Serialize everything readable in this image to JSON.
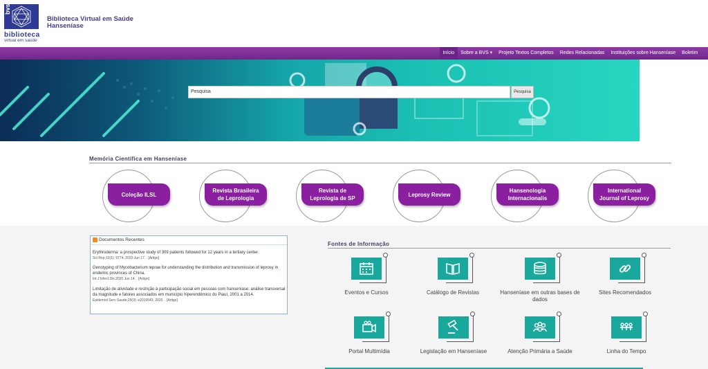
{
  "logo": {
    "mark": "bvs",
    "line1": "biblioteca",
    "line2": "virtual em saúde"
  },
  "site_title": {
    "line1": "Biblioteca Virtual em Saúde",
    "line2": "Hanseníase"
  },
  "nav": [
    {
      "label": "Início",
      "active": true
    },
    {
      "label": "Sobre a BVS ▾",
      "active": false
    },
    {
      "label": "Projeto Textos Completos",
      "active": false
    },
    {
      "label": "Redes Relacionadas",
      "active": false
    },
    {
      "label": "Instituições sobre Hanseníase",
      "active": false
    },
    {
      "label": "Boletim",
      "active": false
    }
  ],
  "search": {
    "placeholder": "Pesquisa",
    "button": "Pesquisa"
  },
  "memoria": {
    "title": "Memória Científica em Hanseníase",
    "items": [
      {
        "line1": "Coleção ILSL",
        "line2": ""
      },
      {
        "line1": "Revista Brasileira",
        "line2": "de Leprologia"
      },
      {
        "line1": "Revista de",
        "line2": "Leprologia de SP"
      },
      {
        "line1": "Leprosy Review",
        "line2": ""
      },
      {
        "line1": "Hansenologia",
        "line2": "Internacionalis"
      },
      {
        "line1": "International",
        "line2": "Journal of Leprosy"
      }
    ]
  },
  "documentos": {
    "title": "Documentos Recentes",
    "items": [
      {
        "text": "Erythroderma: a prospective study of 309 patients followed for 12 years in a tertiary center.",
        "meta": "Sci Rep;10(1): 9774, 2020 Jun 17. . [Artigo]"
      },
      {
        "text": "Genotyping of Mycobacterium leprae for understanding the distribution and transmission of leprosy in endemic provinces of China.",
        "meta": "Int J Infect Dis;2020 Jun 14. . [Artigo]"
      },
      {
        "text": "Limitação de atividade e restrição à participação social em pessoas com hanseníase: análise transversal da magnitude e fatores associados em município hiperendêmico do Piauí, 2001 a 2014.",
        "meta": "Epidemiol Serv Saude;29(3): e2019543, 2020. . [Artigo]"
      }
    ]
  },
  "fontes": {
    "title": "Fontes de Informação",
    "items": [
      {
        "label": "Eventos e Cursos",
        "icon": "calendar-icon"
      },
      {
        "label": "Catálogo de Revistas",
        "icon": "book-icon"
      },
      {
        "label": "Hanseníase em outras bases de dados",
        "icon": "database-icon"
      },
      {
        "label": "Sites Recomendados",
        "icon": "link-icon"
      },
      {
        "label": "Portal Multimídia",
        "icon": "video-camera-icon"
      },
      {
        "label": "Legislação em Hanseníase",
        "icon": "gavel-icon"
      },
      {
        "label": "Atenção Primária a Saúde",
        "icon": "people-icon"
      },
      {
        "label": "Linha do Tempo",
        "icon": "timeline-icon"
      }
    ]
  },
  "colors": {
    "purple": "#8a1fa0",
    "nav": "#7a2f96",
    "teal": "#1aa89c",
    "logo_blue": "#2f3b93"
  }
}
